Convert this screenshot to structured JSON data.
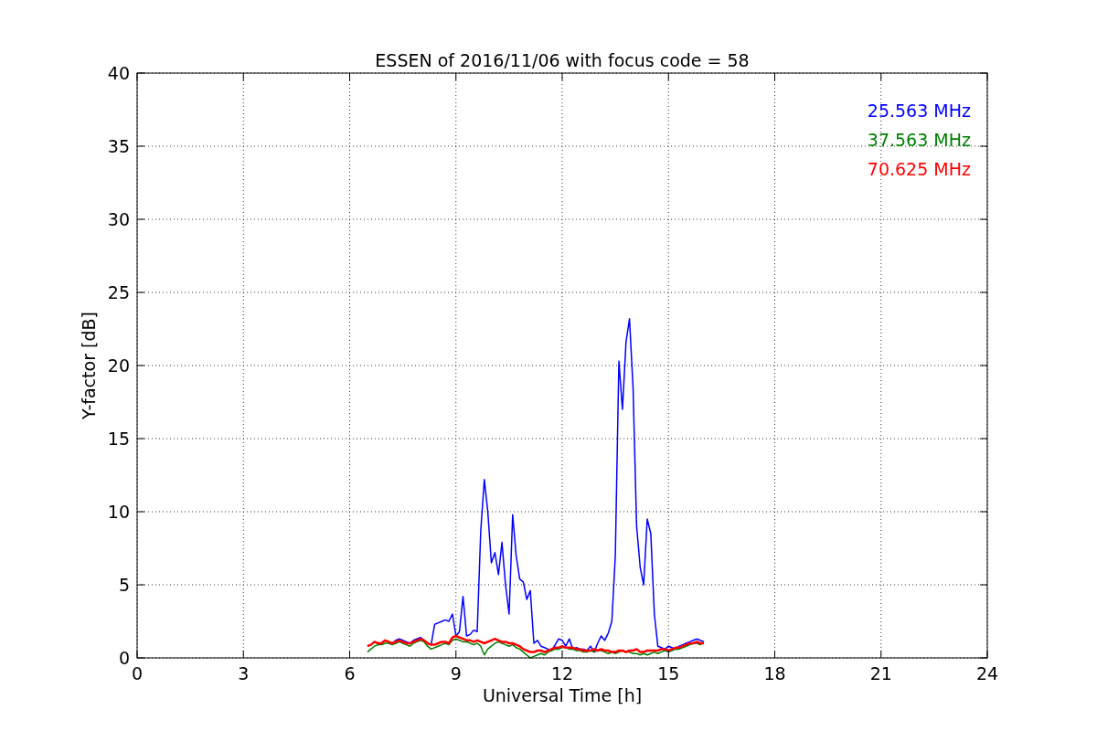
{
  "chart_data": {
    "type": "line",
    "title": "ESSEN of 2016/11/06 with focus code = 58",
    "xlabel": "Universal Time [h]",
    "ylabel": "Y-factor [dB]",
    "xlim": [
      0,
      24
    ],
    "ylim": [
      0,
      40
    ],
    "xticks": [
      0,
      3,
      6,
      9,
      12,
      15,
      18,
      21,
      24
    ],
    "yticks": [
      0,
      5,
      10,
      15,
      20,
      25,
      30,
      35,
      40
    ],
    "grid": true,
    "x": [
      6.5,
      6.6,
      6.7,
      6.8,
      6.9,
      7.0,
      7.1,
      7.2,
      7.3,
      7.4,
      7.5,
      7.6,
      7.7,
      7.8,
      7.9,
      8.0,
      8.1,
      8.2,
      8.3,
      8.4,
      8.5,
      8.6,
      8.7,
      8.8,
      8.9,
      9.0,
      9.1,
      9.2,
      9.3,
      9.4,
      9.5,
      9.6,
      9.7,
      9.8,
      9.9,
      10.0,
      10.1,
      10.2,
      10.3,
      10.4,
      10.5,
      10.6,
      10.7,
      10.8,
      10.9,
      11.0,
      11.1,
      11.2,
      11.3,
      11.4,
      11.5,
      11.6,
      11.7,
      11.8,
      11.9,
      12.0,
      12.1,
      12.2,
      12.3,
      12.4,
      12.5,
      12.6,
      12.7,
      12.8,
      12.9,
      13.0,
      13.1,
      13.2,
      13.3,
      13.4,
      13.5,
      13.6,
      13.7,
      13.8,
      13.9,
      14.0,
      14.1,
      14.2,
      14.3,
      14.4,
      14.5,
      14.6,
      14.7,
      14.8,
      14.9,
      15.0,
      15.1,
      15.2,
      15.3,
      15.4,
      15.5,
      15.6,
      15.7,
      15.8,
      15.9,
      16.0
    ],
    "series": [
      {
        "name": "25.563 MHz",
        "color": "#0000ff",
        "values": [
          null,
          null,
          null,
          null,
          null,
          null,
          null,
          1.0,
          1.2,
          1.3,
          1.2,
          1.1,
          1.0,
          1.2,
          1.3,
          1.4,
          1.2,
          1.0,
          0.9,
          2.3,
          2.4,
          2.5,
          2.6,
          2.5,
          3.0,
          1.5,
          1.8,
          4.2,
          1.5,
          1.6,
          1.9,
          1.8,
          8.7,
          12.2,
          10.0,
          6.5,
          7.2,
          5.7,
          7.9,
          5.0,
          3.0,
          9.8,
          7.0,
          5.4,
          5.2,
          4.0,
          4.6,
          1.0,
          1.2,
          0.8,
          0.7,
          0.6,
          0.5,
          0.9,
          1.3,
          1.2,
          0.8,
          1.3,
          0.6,
          0.7,
          0.6,
          0.6,
          0.5,
          0.8,
          0.4,
          1.0,
          1.5,
          1.2,
          1.7,
          2.5,
          7.0,
          20.3,
          17.0,
          21.6,
          23.2,
          18.5,
          9.0,
          6.2,
          5.0,
          9.5,
          8.5,
          3.0,
          0.8,
          0.7,
          0.6,
          0.8,
          0.7,
          0.6,
          0.8,
          0.9,
          1.0,
          1.1,
          1.2,
          1.3,
          1.2,
          1.1
        ]
      },
      {
        "name": "37.563 MHz",
        "color": "#008000",
        "values": [
          0.4,
          0.6,
          0.8,
          0.9,
          0.9,
          1.0,
          1.0,
          0.9,
          1.0,
          1.1,
          1.0,
          0.9,
          0.8,
          1.0,
          1.1,
          1.2,
          1.1,
          0.8,
          0.6,
          0.7,
          0.8,
          0.9,
          1.0,
          0.9,
          1.2,
          1.3,
          1.2,
          1.1,
          1.1,
          1.0,
          0.9,
          1.0,
          0.8,
          0.2,
          0.6,
          0.8,
          1.0,
          1.1,
          1.0,
          0.9,
          0.8,
          0.9,
          0.7,
          0.6,
          0.4,
          0.2,
          0.0,
          0.1,
          0.2,
          0.3,
          0.2,
          0.4,
          0.5,
          0.6,
          0.6,
          0.7,
          0.7,
          0.6,
          0.6,
          0.5,
          0.5,
          0.4,
          0.4,
          0.5,
          0.4,
          0.5,
          0.5,
          0.4,
          0.3,
          0.4,
          0.3,
          0.4,
          0.5,
          0.4,
          0.4,
          0.3,
          0.3,
          0.2,
          0.3,
          0.2,
          0.3,
          0.4,
          0.3,
          0.4,
          0.5,
          0.4,
          0.5,
          0.6,
          0.6,
          0.7,
          0.8,
          0.9,
          1.0,
          1.0,
          0.9,
          1.1
        ]
      },
      {
        "name": "70.625 MHz",
        "color": "#ff0000",
        "values": [
          0.8,
          0.9,
          1.1,
          1.0,
          1.0,
          1.2,
          1.1,
          1.0,
          1.1,
          1.2,
          1.1,
          1.0,
          1.0,
          1.1,
          1.2,
          1.3,
          1.2,
          1.0,
          0.9,
          0.9,
          1.0,
          1.1,
          1.1,
          1.0,
          1.4,
          1.5,
          1.4,
          1.3,
          1.2,
          1.2,
          1.1,
          1.2,
          1.1,
          1.0,
          1.1,
          1.2,
          1.3,
          1.2,
          1.1,
          1.1,
          1.0,
          1.0,
          0.9,
          0.8,
          0.6,
          0.5,
          0.4,
          0.4,
          0.5,
          0.5,
          0.4,
          0.5,
          0.6,
          0.7,
          0.7,
          0.8,
          0.7,
          0.7,
          0.7,
          0.6,
          0.6,
          0.5,
          0.5,
          0.5,
          0.6,
          0.5,
          0.6,
          0.5,
          0.5,
          0.4,
          0.4,
          0.5,
          0.5,
          0.4,
          0.5,
          0.5,
          0.6,
          0.4,
          0.4,
          0.5,
          0.5,
          0.5,
          0.5,
          0.6,
          0.6,
          0.5,
          0.6,
          0.7,
          0.7,
          0.8,
          0.9,
          1.0,
          1.0,
          1.1,
          1.0,
          1.0
        ]
      }
    ]
  }
}
